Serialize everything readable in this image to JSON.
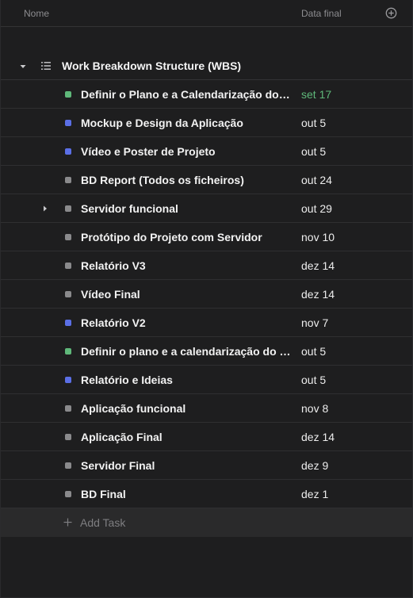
{
  "header": {
    "name_col": "Nome",
    "date_col": "Data final",
    "add_column_icon": "plus-circle-icon"
  },
  "section": {
    "title": "Work Breakdown Structure (WBS)",
    "collapse_icon": "caret-down-icon",
    "list_icon": "list-icon"
  },
  "tasks": [
    {
      "name": "Definir o Plano e a Calendarização do projeto",
      "due": "set 17",
      "color": "#5fb87a",
      "due_color": "green",
      "has_subtasks": false
    },
    {
      "name": "Mockup e Design da Aplicação",
      "due": "out 5",
      "color": "#5b6fe6",
      "due_color": "default",
      "has_subtasks": false
    },
    {
      "name": "Vídeo e Poster de Projeto",
      "due": "out 5",
      "color": "#5b6fe6",
      "due_color": "default",
      "has_subtasks": false
    },
    {
      "name": "BD Report (Todos os ficheiros)",
      "due": "out 24",
      "color": "#8a8a8c",
      "due_color": "default",
      "has_subtasks": false
    },
    {
      "name": "Servidor funcional",
      "due": "out 29",
      "color": "#8a8a8c",
      "due_color": "default",
      "has_subtasks": true
    },
    {
      "name": "Protótipo do Projeto com Servidor",
      "due": "nov 10",
      "color": "#8a8a8c",
      "due_color": "default",
      "has_subtasks": false
    },
    {
      "name": "Relatório V3",
      "due": "dez 14",
      "color": "#8a8a8c",
      "due_color": "default",
      "has_subtasks": false
    },
    {
      "name": "Vídeo Final",
      "due": "dez 14",
      "color": "#8a8a8c",
      "due_color": "default",
      "has_subtasks": false
    },
    {
      "name": "Relatório V2",
      "due": "nov 7",
      "color": "#5b6fe6",
      "due_color": "default",
      "has_subtasks": false
    },
    {
      "name": "Definir o plano e a calendarização do projeto",
      "due": "out 5",
      "color": "#5fb87a",
      "due_color": "default",
      "has_subtasks": false
    },
    {
      "name": "Relatório e Ideias",
      "due": "out 5",
      "color": "#5b6fe6",
      "due_color": "default",
      "has_subtasks": false
    },
    {
      "name": "Aplicação funcional",
      "due": "nov 8",
      "color": "#8a8a8c",
      "due_color": "default",
      "has_subtasks": false
    },
    {
      "name": "Aplicação Final",
      "due": "dez 14",
      "color": "#8a8a8c",
      "due_color": "default",
      "has_subtasks": false
    },
    {
      "name": "Servidor Final",
      "due": "dez 9",
      "color": "#8a8a8c",
      "due_color": "default",
      "has_subtasks": false
    },
    {
      "name": "BD Final",
      "due": "dez 1",
      "color": "#8a8a8c",
      "due_color": "default",
      "has_subtasks": false
    }
  ],
  "add_task": {
    "label": "Add Task",
    "icon": "plus-icon"
  }
}
